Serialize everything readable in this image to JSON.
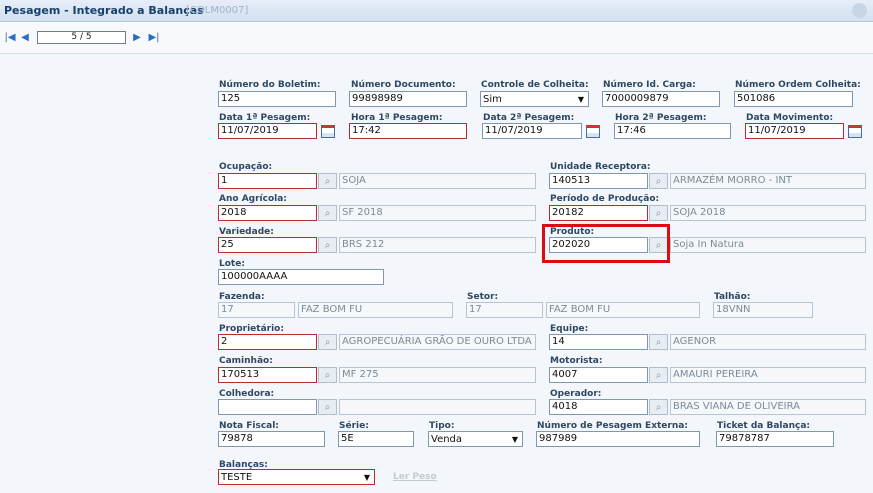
{
  "window": {
    "title": "Pesagem - Integrado a Balanças",
    "code": "[COLM0007]"
  },
  "toolbar": {
    "record": "5 / 5"
  },
  "form": {
    "numero_boletim": {
      "label": "Número do Boletim:",
      "value": "125"
    },
    "numero_documento": {
      "label": "Número Documento:",
      "value": "99898989"
    },
    "controle_colheita": {
      "label": "Controle de Colheita:",
      "value": "Sim"
    },
    "numero_id_carga": {
      "label": "Número Id. Carga:",
      "value": "7000009879"
    },
    "numero_ordem_colheita": {
      "label": "Número Ordem Colheita:",
      "value": "501086"
    },
    "data_1_pesagem": {
      "label": "Data 1ª Pesagem:",
      "value": "11/07/2019"
    },
    "hora_1_pesagem": {
      "label": "Hora 1ª Pesagem:",
      "value": "17:42"
    },
    "data_2_pesagem": {
      "label": "Data 2ª Pesagem:",
      "value": "11/07/2019"
    },
    "hora_2_pesagem": {
      "label": "Hora 2ª Pesagem:",
      "value": "17:46"
    },
    "data_movimento": {
      "label": "Data Movimento:",
      "value": "11/07/2019"
    },
    "ocupacao": {
      "label": "Ocupação:",
      "code": "1",
      "desc": "SOJA"
    },
    "unidade_receptora": {
      "label": "Unidade Receptora:",
      "code": "140513",
      "desc": "ARMAZÉM MORRO - INT"
    },
    "ano_agricola": {
      "label": "Ano Agrícola:",
      "code": "2018",
      "desc": "SF 2018"
    },
    "periodo_producao": {
      "label": "Período de Produção:",
      "code": "20182",
      "desc": "SOJA 2018"
    },
    "variedade": {
      "label": "Variedade:",
      "code": "25",
      "desc": "BRS 212"
    },
    "produto": {
      "label": "Produto:",
      "code": "202020",
      "desc": "Soja In Natura"
    },
    "lote": {
      "label": "Lote:",
      "value": "100000AAAA"
    },
    "fazenda": {
      "label": "Fazenda:",
      "code": "17",
      "desc": "FAZ BOM FU"
    },
    "setor": {
      "label": "Setor:",
      "code": "17",
      "desc": "FAZ BOM FU"
    },
    "talhao": {
      "label": "Talhão:",
      "value": "18VNN"
    },
    "proprietario": {
      "label": "Proprietário:",
      "code": "2",
      "desc": "AGROPECUÁRIA GRÃO DE OURO LTDA"
    },
    "equipe": {
      "label": "Equipe:",
      "code": "14",
      "desc": "AGENOR"
    },
    "caminhao": {
      "label": "Caminhão:",
      "code": "170513",
      "desc": "MF 275"
    },
    "motorista": {
      "label": "Motorista:",
      "code": "4007",
      "desc": "AMAURI PEREIRA"
    },
    "colhedora": {
      "label": "Colhedora:",
      "code": "",
      "desc": ""
    },
    "operador": {
      "label": "Operador:",
      "code": "4018",
      "desc": "BRAS VIANA DE OLIVEIRA"
    },
    "nota_fiscal": {
      "label": "Nota Fiscal:",
      "value": "79878"
    },
    "serie": {
      "label": "Série:",
      "value": "5E"
    },
    "tipo": {
      "label": "Tipo:",
      "value": "Venda"
    },
    "numero_pesagem_externa": {
      "label": "Número de Pesagem Externa:",
      "value": "987989"
    },
    "ticket_balanca": {
      "label": "Ticket da Balança:",
      "value": "79878787"
    },
    "balancas": {
      "label": "Balanças:",
      "value": "TESTE"
    },
    "ler_peso": "Ler Peso"
  }
}
